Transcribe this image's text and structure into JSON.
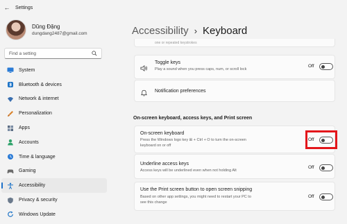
{
  "window": {
    "title": "Settings",
    "back_icon": "back-arrow-icon"
  },
  "profile": {
    "name": "Dũng Đặng",
    "email": "dungdang2487@gmail.com"
  },
  "search": {
    "placeholder": "Find a setting"
  },
  "nav": {
    "items": [
      {
        "label": "System",
        "icon": "monitor-icon",
        "color": "#2a7bd6"
      },
      {
        "label": "Bluetooth & devices",
        "icon": "bluetooth-icon",
        "color": "#1e74c7"
      },
      {
        "label": "Network & internet",
        "icon": "wifi-icon",
        "color": "#3a6fb0"
      },
      {
        "label": "Personalization",
        "icon": "brush-icon",
        "color": "#d9822b"
      },
      {
        "label": "Apps",
        "icon": "apps-icon",
        "color": "#5b6d84"
      },
      {
        "label": "Accounts",
        "icon": "person-icon",
        "color": "#2fa36b"
      },
      {
        "label": "Time & language",
        "icon": "globe-clock-icon",
        "color": "#2a7bd6"
      },
      {
        "label": "Gaming",
        "icon": "controller-icon",
        "color": "#6b6b6b"
      },
      {
        "label": "Accessibility",
        "icon": "accessibility-icon",
        "color": "#1e74c7",
        "active": true
      },
      {
        "label": "Privacy & security",
        "icon": "shield-icon",
        "color": "#6b7a8c"
      },
      {
        "label": "Windows Update",
        "icon": "update-icon",
        "color": "#1e74c7"
      }
    ]
  },
  "breadcrumb": {
    "parent": "Accessibility",
    "separator": "›",
    "current": "Keyboard"
  },
  "fragment_text": "one or repeated keystrokes",
  "toggle_keys": {
    "title": "Toggle keys",
    "description": "Play a sound when you press caps, num, or scroll lock",
    "state": "Off",
    "icon": "speaker-icon"
  },
  "notification_prefs": {
    "title": "Notification preferences",
    "icon": "bell-icon"
  },
  "section": {
    "title": "On-screen keyboard, access keys, and Print screen"
  },
  "onscreen_keyboard": {
    "title": "On-screen keyboard",
    "description_line1": "Press the Windows logo key ⊞ + Ctrl + O to turn the on-screen",
    "description_line2": "keyboard on or off",
    "state": "Off"
  },
  "underline_keys": {
    "title": "Underline access keys",
    "description": "Access keys will be underlined even when not holding Alt",
    "state": "Off"
  },
  "print_screen": {
    "title": "Use the Print screen button to open screen snipping",
    "description_line1": "Based on other app settings, you might need to restart your PC to",
    "description_line2": "see this change",
    "state": "Off"
  },
  "colors": {
    "accent": "#1a6fc9",
    "highlight": "#e3161b"
  }
}
